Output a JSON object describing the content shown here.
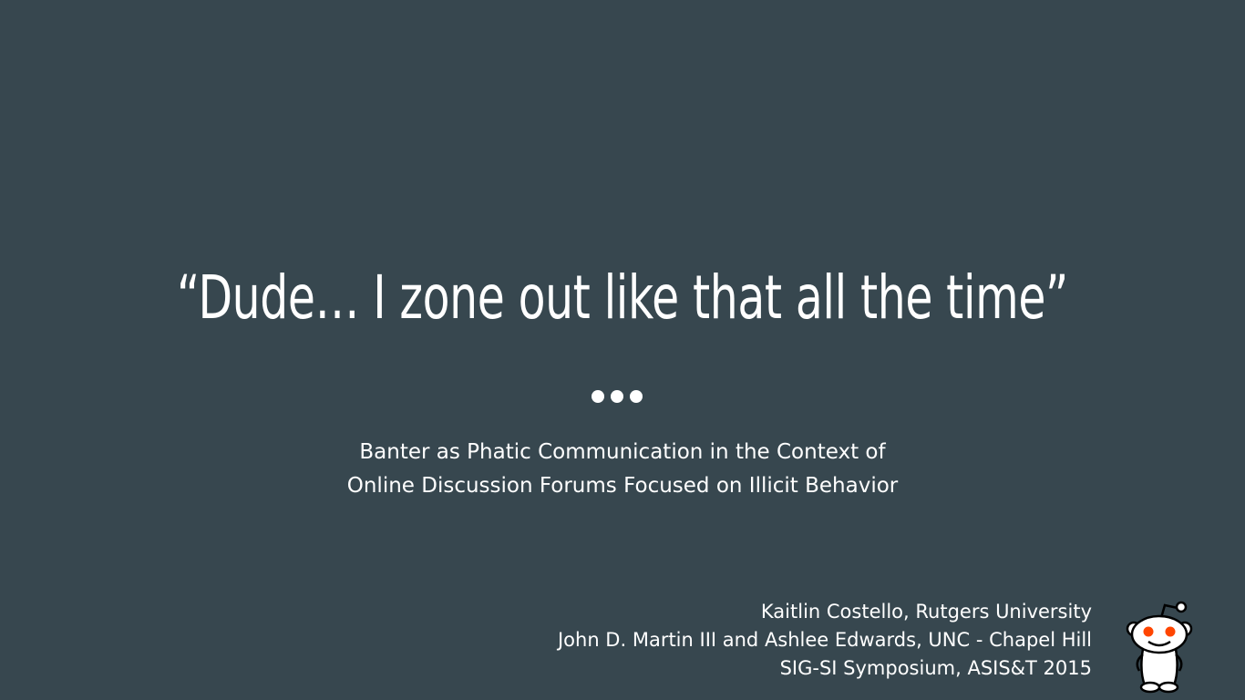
{
  "slide": {
    "title": "“Dude… I zone out like that all the time”",
    "subtitle_lines": [
      "Banter as Phatic Communication in the Context of",
      "Online Discussion Forums Focused on Illicit Behavior"
    ],
    "authors": [
      "Kaitlin Costello, Rutgers University",
      "John D. Martin III and Ashlee Edwards, UNC - Chapel Hill",
      "SIG-SI Symposium, ASIS&T 2015"
    ],
    "mascot_icon": "reddit-alien-icon",
    "colors": {
      "background": "#37474f",
      "text": "#ffffff",
      "mascot_eyes": "#ff4500"
    }
  }
}
